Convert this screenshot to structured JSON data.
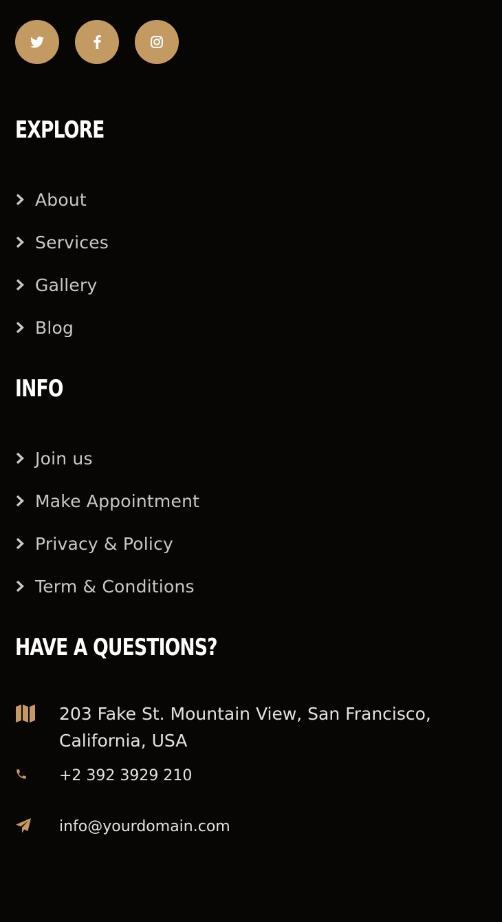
{
  "social": [
    {
      "name": "twitter",
      "icon": "twitter-icon"
    },
    {
      "name": "facebook",
      "icon": "facebook-icon"
    },
    {
      "name": "instagram",
      "icon": "instagram-icon"
    }
  ],
  "explore": {
    "title": "EXPLORE",
    "items": [
      {
        "label": "About"
      },
      {
        "label": "Services"
      },
      {
        "label": "Gallery"
      },
      {
        "label": "Blog"
      }
    ]
  },
  "info": {
    "title": "INFO",
    "items": [
      {
        "label": "Join us"
      },
      {
        "label": "Make Appointment"
      },
      {
        "label": "Privacy & Policy"
      },
      {
        "label": "Term & Conditions"
      }
    ]
  },
  "contact": {
    "title": "HAVE A QUESTIONS?",
    "address": "203 Fake St. Mountain View, San Francisco, California, USA",
    "phone": "+2 392 3929 210",
    "email": "info@yourdomain.com"
  },
  "colors": {
    "background": "#080604",
    "accent": "#c49a63",
    "link_text": "#c8c8c8",
    "heading_text": "#ffffff"
  }
}
